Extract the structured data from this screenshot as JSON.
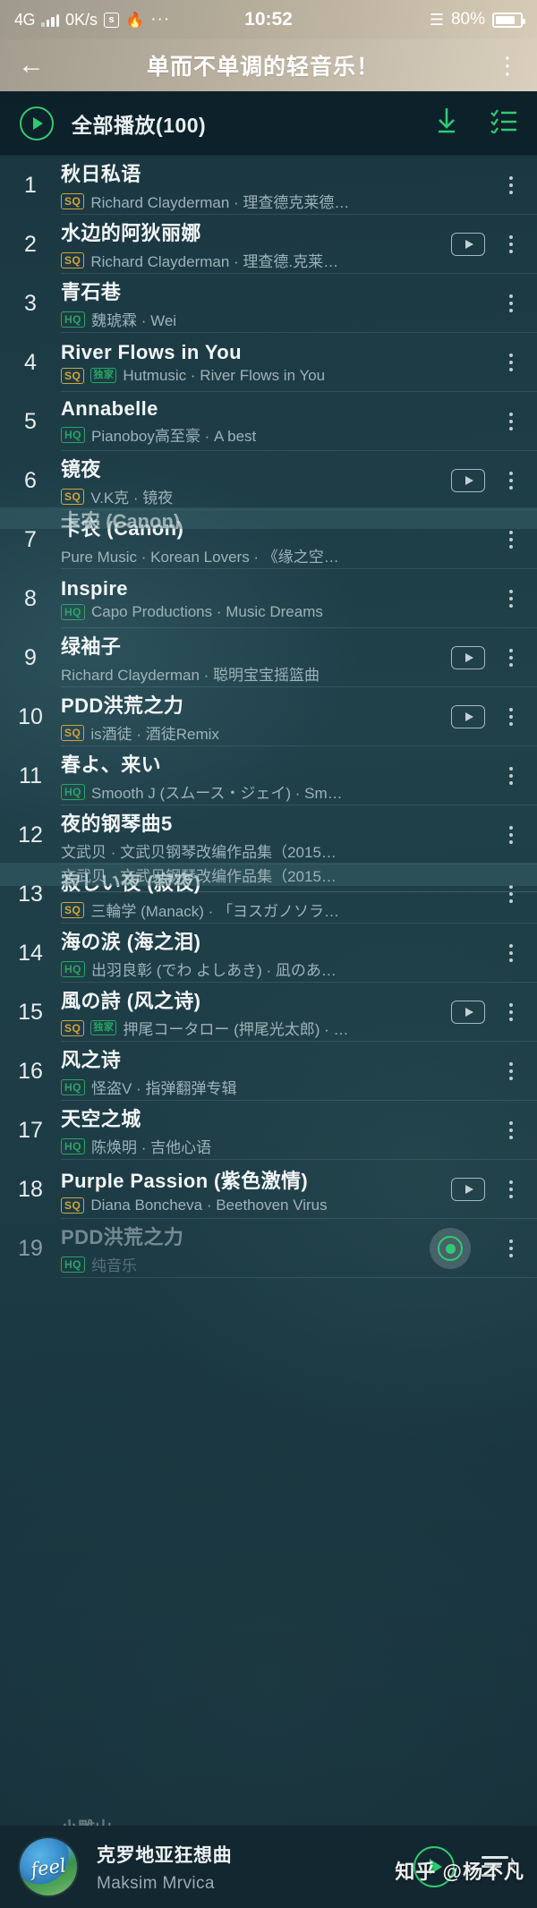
{
  "status_bar": {
    "network": "4G",
    "speed": "0K/s",
    "sq_icon": "s",
    "flame_icon": "flame-icon",
    "more_icon": "···",
    "time": "10:52",
    "wifi_icon": "wifi-icon",
    "battery_pct": "80%"
  },
  "header": {
    "back_icon": "←",
    "title": "单而不单调的轻音乐！",
    "overflow_icon": "kebab-icon"
  },
  "playall": {
    "play_icon": "play-circle-icon",
    "label": "全部播放(100)",
    "download_icon": "download-icon",
    "multiselect_icon": "checklist-icon"
  },
  "colors": {
    "accent_green": "#2ecc71",
    "badge_sq": "#d3a43c",
    "badge_hq": "#29a663",
    "panel_dark": "#132730"
  },
  "tracks": [
    {
      "num": "1",
      "title": "秋日私语",
      "badge": "SQ",
      "exclusive": false,
      "artist": "Richard Clayderman · 理查德克莱德…",
      "mv": false,
      "dim": false
    },
    {
      "num": "2",
      "title": "水边的阿狄丽娜",
      "badge": "SQ",
      "exclusive": false,
      "artist": "Richard Clayderman · 理查德.克莱…",
      "mv": true,
      "dim": false
    },
    {
      "num": "3",
      "title": "青石巷",
      "badge": "HQ",
      "exclusive": false,
      "artist": "魏琥霖 · Wei",
      "mv": false,
      "dim": false
    },
    {
      "num": "4",
      "title": "River Flows in You",
      "badge": "SQ",
      "exclusive": true,
      "artist": "Hutmusic · River Flows in You",
      "mv": false,
      "dim": false
    },
    {
      "num": "5",
      "title": "Annabelle",
      "badge": "HQ",
      "exclusive": false,
      "artist": "Pianoboy高至豪 · A best",
      "mv": false,
      "dim": false
    },
    {
      "num": "6",
      "title": "镜夜",
      "badge": "SQ",
      "exclusive": false,
      "artist": "V.K克 · 镜夜",
      "mv": true,
      "dim": false
    },
    {
      "num": "7",
      "title": "卡农 (Canon)",
      "badge": "",
      "exclusive": false,
      "artist": "Pure Music · Korean Lovers · 《缘之空…",
      "mv": false,
      "dim": false
    },
    {
      "num": "8",
      "title": "Inspire",
      "badge": "HQ",
      "exclusive": false,
      "artist": "Capo Productions · Music Dreams",
      "mv": false,
      "dim": false
    },
    {
      "num": "9",
      "title": "绿袖子",
      "badge": "",
      "exclusive": false,
      "artist": "Richard Clayderman · 聪明宝宝摇篮曲",
      "mv": true,
      "dim": false
    },
    {
      "num": "10",
      "title": "PDD洪荒之力",
      "badge": "SQ",
      "exclusive": false,
      "artist": "is酒徒 · 酒徒Remix",
      "mv": true,
      "dim": false
    },
    {
      "num": "11",
      "title": "春よ、来い",
      "badge": "HQ",
      "exclusive": false,
      "artist": "Smooth J (スムース・ジェイ) · Sm…",
      "mv": false,
      "dim": false
    },
    {
      "num": "12",
      "title": "夜的钢琴曲5",
      "badge": "",
      "exclusive": false,
      "artist": "文武贝 · 文武贝钢琴改编作品集（2015…",
      "mv": false,
      "dim": false
    },
    {
      "num": "13",
      "title": "寂しい夜 (寂夜)",
      "badge": "SQ",
      "exclusive": false,
      "artist": "三輪学 (Manack) · 「ヨスガノソラ…",
      "mv": false,
      "dim": false
    },
    {
      "num": "14",
      "title": "海の涙 (海之泪)",
      "badge": "HQ",
      "exclusive": false,
      "artist": "出羽良彰 (でわ よしあき) · 凪のあ…",
      "mv": false,
      "dim": false
    },
    {
      "num": "15",
      "title": "風の詩 (风之诗)",
      "badge": "SQ",
      "exclusive": true,
      "artist": "押尾コータロー (押尾光太郎) · …",
      "mv": true,
      "dim": false
    },
    {
      "num": "16",
      "title": "风之诗",
      "badge": "HQ",
      "exclusive": false,
      "artist": "怪盗V · 指弹翻弹专辑",
      "mv": false,
      "dim": false
    },
    {
      "num": "17",
      "title": "天空之城",
      "badge": "HQ",
      "exclusive": false,
      "artist": "陈焕明 · 吉他心语",
      "mv": false,
      "dim": false
    },
    {
      "num": "18",
      "title": "Purple Passion (紫色激情)",
      "badge": "SQ",
      "exclusive": false,
      "artist": "Diana Boncheva · Beethoven Virus",
      "mv": true,
      "dim": false
    },
    {
      "num": "19",
      "title": "PDD洪荒之力",
      "badge": "HQ",
      "exclusive": false,
      "artist": "纯音乐",
      "mv": false,
      "dim": true
    }
  ],
  "tear_artifacts": {
    "canon_title": "卡农 (Canon)",
    "piano_sub": "文武贝 · 文武贝钢琴改编作品集（2015…",
    "partial_title": "小雕山"
  },
  "player": {
    "album_art": "album-art",
    "title": "克罗地亚狂想曲",
    "artist": "Maksim Mrvica",
    "play_icon": "play-circle-icon",
    "queue_icon": "queue-icon"
  },
  "watermark": "知乎 @杨不凡"
}
